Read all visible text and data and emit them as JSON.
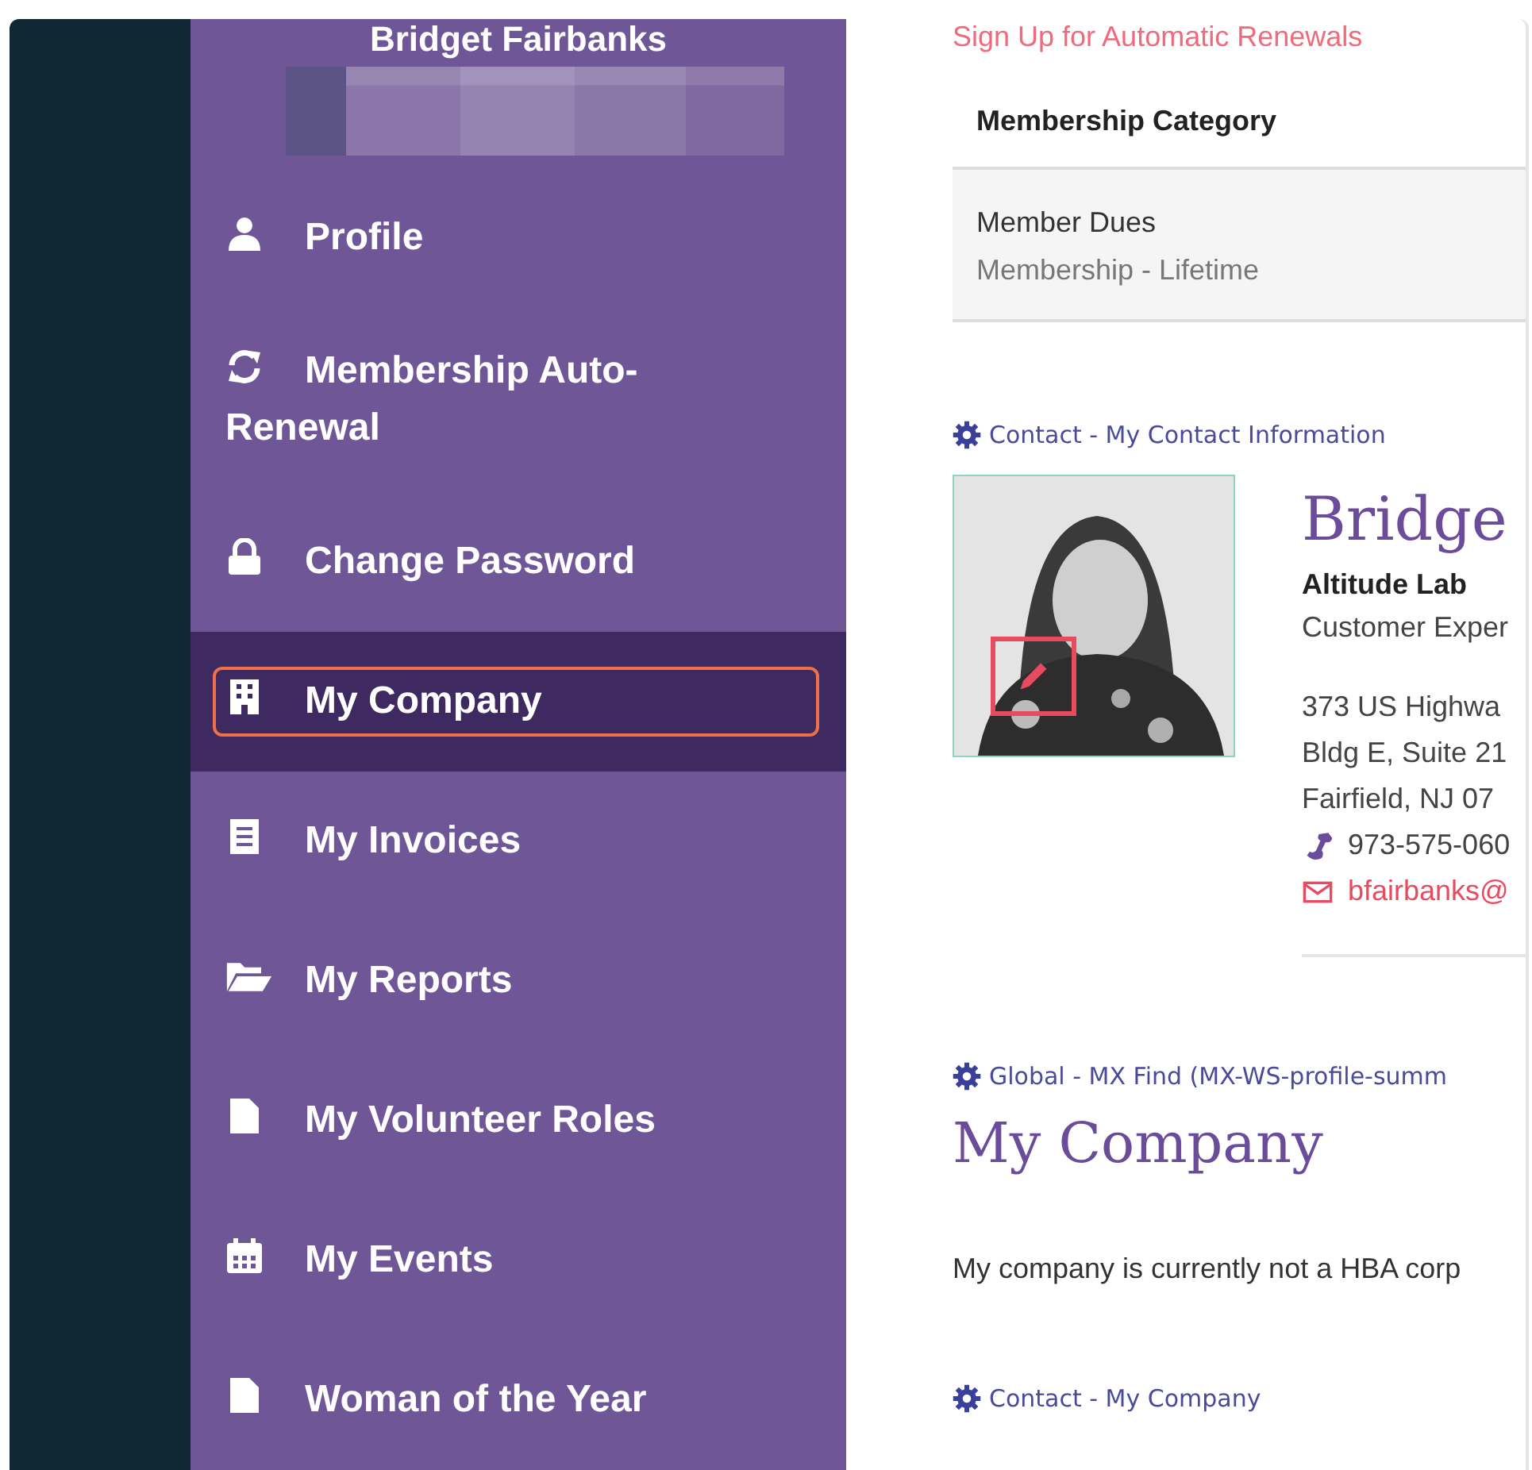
{
  "sidebar": {
    "user_name": "Bridget Fairbanks",
    "items": [
      {
        "label": "Profile",
        "kind": "user",
        "selected": false
      },
      {
        "label": "Membership Auto-Renewal",
        "kind": "sync",
        "selected": false
      },
      {
        "label": "Change Password",
        "kind": "lock",
        "selected": false
      },
      {
        "label": "My Company",
        "kind": "building",
        "selected": true
      },
      {
        "label": "My Invoices",
        "kind": "receipt",
        "selected": false
      },
      {
        "label": "My Reports",
        "kind": "folder",
        "selected": false
      },
      {
        "label": "My Volunteer Roles",
        "kind": "file",
        "selected": false
      },
      {
        "label": "My Events",
        "kind": "calendar",
        "selected": false
      },
      {
        "label": "Woman of the Year",
        "kind": "file",
        "selected": false
      }
    ]
  },
  "renewal_link": "Sign Up for Automatic Renewals",
  "membership_table": {
    "column": "Membership Category",
    "rows": [
      {
        "title": "Member Dues",
        "subtitle": "Membership - Lifetime"
      }
    ]
  },
  "contact_section": {
    "heading": "Contact - My Contact Information",
    "name": "Bridge",
    "company": "Altitude Lab",
    "job_title": "Customer Exper",
    "address": [
      "373 US Highwa",
      "Bldg E, Suite 21",
      "Fairfield, NJ 07"
    ],
    "phone": "973-575-060",
    "email": "bfairbanks@"
  },
  "company_section": {
    "heading": "Global - MX Find (MX-WS-profile-summ",
    "title": "My Company",
    "text": "My company is currently not a HBA corp"
  },
  "next_section": {
    "heading": "Contact - My Company"
  }
}
